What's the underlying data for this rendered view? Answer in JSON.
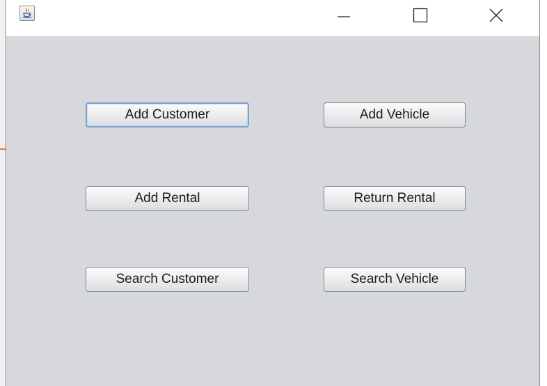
{
  "window": {
    "icon": "java-coffee-icon",
    "controls": {
      "minimize_icon": "minimize-icon",
      "maximize_icon": "maximize-icon",
      "close_icon": "close-icon"
    }
  },
  "buttons": {
    "add_customer": "Add Customer",
    "add_vehicle": "Add Vehicle",
    "add_rental": "Add Rental",
    "return_rental": "Return Rental",
    "search_customer": "Search Customer",
    "search_vehicle": "Search Vehicle"
  },
  "colors": {
    "content_background": "#d7d8dc",
    "focus_border": "#7aa3cf"
  }
}
